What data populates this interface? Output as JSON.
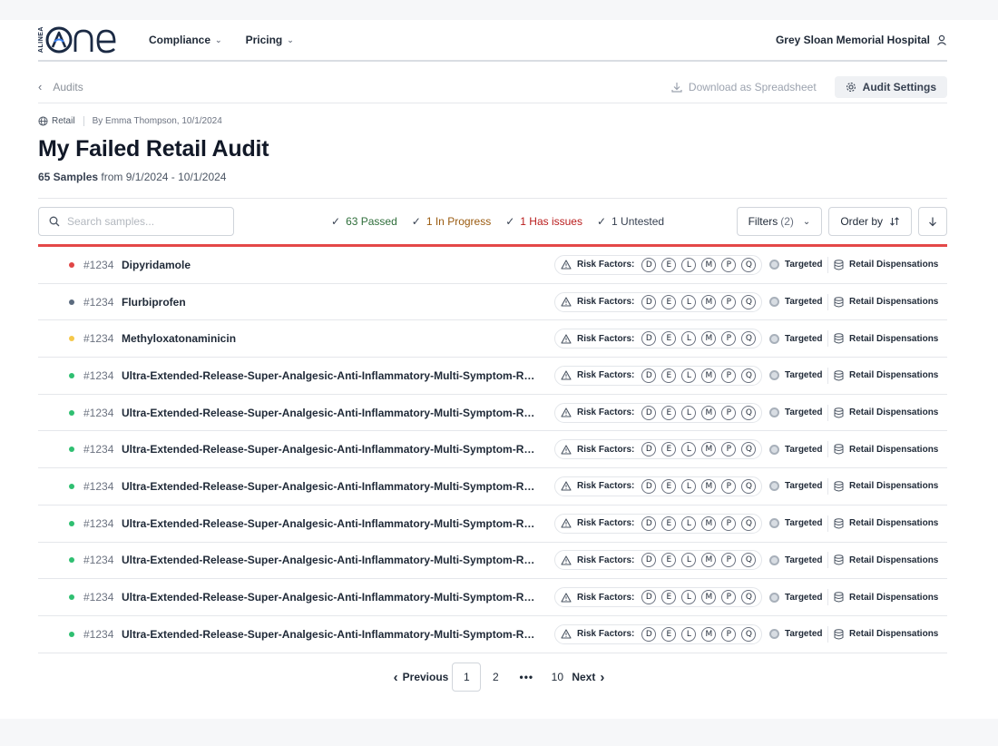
{
  "nav": {
    "logo_text": "ALINEA",
    "menu": [
      {
        "label": "Compliance"
      },
      {
        "label": "Pricing"
      }
    ],
    "account_name": "Grey Sloan Memorial Hospital"
  },
  "crumb": {
    "back_label": "Audits",
    "download_label": "Download as Spreadsheet",
    "settings_label": "Audit Settings"
  },
  "header": {
    "category": "Retail",
    "author": "By Emma Thompson, 10/1/2024",
    "title": "My Failed Retail Audit",
    "sample_count": "65 Samples",
    "date_range": "from 9/1/2024 - 10/1/2024"
  },
  "toolbar": {
    "search_placeholder": "Search samples...",
    "statuses": [
      {
        "label": "63 Passed"
      },
      {
        "label": "1 In Progress"
      },
      {
        "label": "1 Has issues"
      },
      {
        "label": "1 Untested"
      }
    ],
    "filters_label": "Filters",
    "filters_count": "(2)",
    "order_label": "Order by"
  },
  "colors": {
    "failed": "#e04545",
    "untested": "#5b6b7e",
    "in_progress": "#f5c84a",
    "passed": "#2fbf71",
    "accent_bar": "#e44848"
  },
  "risk_label": "Risk Factors:",
  "risk_factors": [
    "D",
    "E",
    "L",
    "M",
    "P",
    "Q"
  ],
  "rows": [
    {
      "status": "failed",
      "id": "#1234",
      "name": "Dipyridamole",
      "type": "Targeted",
      "source": "Retail Dispensations"
    },
    {
      "status": "untested",
      "id": "#1234",
      "name": "Flurbiprofen",
      "type": "Targeted",
      "source": "Retail Dispensations"
    },
    {
      "status": "in_progress",
      "id": "#1234",
      "name": "Methyloxatonaminicin",
      "type": "Targeted",
      "source": "Retail Dispensations"
    },
    {
      "status": "passed",
      "id": "#1234",
      "name": "Ultra-Extended-Release-Super-Analgesic-Anti-Inflammatory-Multi-Symptom-Relief-Co...",
      "type": "Targeted",
      "source": "Retail Dispensations"
    },
    {
      "status": "passed",
      "id": "#1234",
      "name": "Ultra-Extended-Release-Super-Analgesic-Anti-Inflammatory-Multi-Symptom-Relief-Co...",
      "type": "Targeted",
      "source": "Retail Dispensations"
    },
    {
      "status": "passed",
      "id": "#1234",
      "name": "Ultra-Extended-Release-Super-Analgesic-Anti-Inflammatory-Multi-Symptom-Relief-Co...",
      "type": "Targeted",
      "source": "Retail Dispensations"
    },
    {
      "status": "passed",
      "id": "#1234",
      "name": "Ultra-Extended-Release-Super-Analgesic-Anti-Inflammatory-Multi-Symptom-Relief-Co...",
      "type": "Targeted",
      "source": "Retail Dispensations"
    },
    {
      "status": "passed",
      "id": "#1234",
      "name": "Ultra-Extended-Release-Super-Analgesic-Anti-Inflammatory-Multi-Symptom-Relief-Co...",
      "type": "Targeted",
      "source": "Retail Dispensations"
    },
    {
      "status": "passed",
      "id": "#1234",
      "name": "Ultra-Extended-Release-Super-Analgesic-Anti-Inflammatory-Multi-Symptom-Relief-Co...",
      "type": "Targeted",
      "source": "Retail Dispensations"
    },
    {
      "status": "passed",
      "id": "#1234",
      "name": "Ultra-Extended-Release-Super-Analgesic-Anti-Inflammatory-Multi-Symptom-Relief-Co...",
      "type": "Targeted",
      "source": "Retail Dispensations"
    },
    {
      "status": "passed",
      "id": "#1234",
      "name": "Ultra-Extended-Release-Super-Analgesic-Anti-Inflammatory-Multi-Symptom-Relief-Co...",
      "type": "Targeted",
      "source": "Retail Dispensations"
    }
  ],
  "pagination": {
    "prev_label": "Previous",
    "next_label": "Next",
    "pages": [
      "1",
      "2"
    ],
    "ellipsis": "•••",
    "last_page": "10",
    "current": "1"
  }
}
